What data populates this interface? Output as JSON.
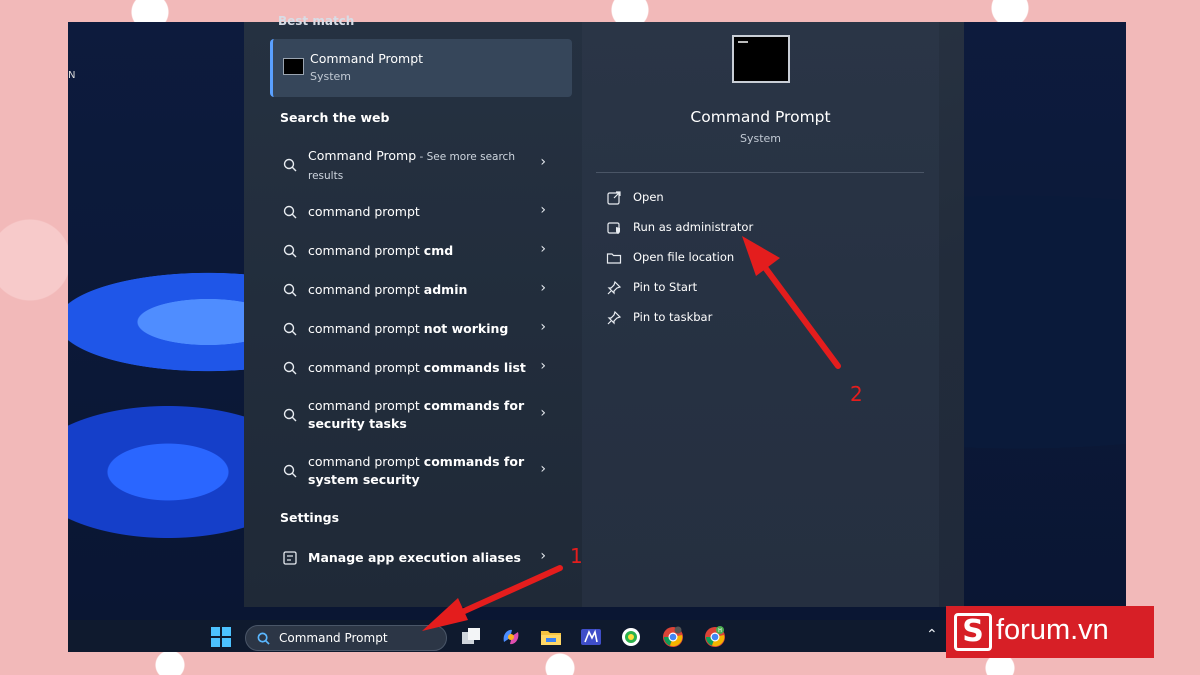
{
  "desktop": {
    "edge_char": "N"
  },
  "best_match": {
    "label": "Best match",
    "title": "Command Prompt",
    "subtitle": "System"
  },
  "web": {
    "label": "Search the web",
    "items": [
      {
        "pre": "Command Promp",
        "bold": "",
        "note": " - See more search results"
      },
      {
        "pre": "command prompt",
        "bold": "",
        "note": ""
      },
      {
        "pre": "command prompt ",
        "bold": "cmd",
        "note": ""
      },
      {
        "pre": "command prompt ",
        "bold": "admin",
        "note": ""
      },
      {
        "pre": "command prompt ",
        "bold": "not working",
        "note": ""
      },
      {
        "pre": "command prompt ",
        "bold": "commands list",
        "note": ""
      },
      {
        "pre": "command prompt ",
        "bold": "commands for security tasks",
        "note": ""
      },
      {
        "pre": "command prompt ",
        "bold": "commands for system security",
        "note": ""
      }
    ]
  },
  "settings": {
    "label": "Settings",
    "item": "Manage app execution aliases"
  },
  "preview": {
    "title": "Command Prompt",
    "subtitle": "System",
    "actions": [
      {
        "label": "Open",
        "icon": "open-external-icon"
      },
      {
        "label": "Run as administrator",
        "icon": "shield-icon"
      },
      {
        "label": "Open file location",
        "icon": "folder-icon"
      },
      {
        "label": "Pin to Start",
        "icon": "pin-icon"
      },
      {
        "label": "Pin to taskbar",
        "icon": "pin-icon"
      }
    ]
  },
  "taskbar": {
    "search_text": "Command Prompt",
    "icons": [
      "windows-start-icon",
      "task-view-icon",
      "copilot-icon",
      "file-explorer-icon",
      "store-icon",
      "browser-icon",
      "chrome-icon",
      "chrome-profile-icon"
    ]
  },
  "annotations": {
    "step1": "1",
    "step2": "2"
  },
  "watermark": {
    "letter": "S",
    "text": "forum.vn"
  },
  "colors": {
    "accent": "#5aa0ff",
    "annotation": "#e41d1d",
    "brand": "#d71f26"
  }
}
